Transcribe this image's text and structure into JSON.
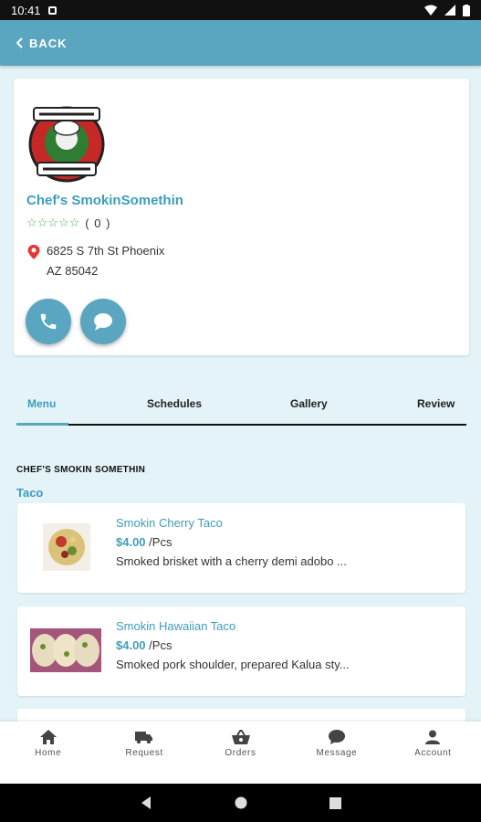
{
  "status_bar": {
    "time": "10:41"
  },
  "app_bar": {
    "back_label": "BACK"
  },
  "profile": {
    "name": "Chef's SmokinSomethin",
    "rating_stars": "☆☆☆☆☆",
    "rating_count": "( 0 )",
    "address_line1": "6825 S 7th St Phoenix",
    "address_line2": "AZ 85042"
  },
  "tabs": [
    "Menu",
    "Schedules",
    "Gallery",
    "Review"
  ],
  "menu": {
    "section_title": "CHEF'S SMOKIN SOMETHIN",
    "category": "Taco",
    "items": [
      {
        "name": "Smokin Cherry Taco",
        "price": "$4.00",
        "unit": "/Pcs",
        "description": "Smoked brisket with a cherry demi adobo ..."
      },
      {
        "name": "Smokin Hawaiian Taco",
        "price": "$4.00",
        "unit": "/Pcs",
        "description": "Smoked pork shoulder, prepared Kalua sty..."
      }
    ]
  },
  "bottom_nav": [
    "Home",
    "Request",
    "Orders",
    "Message",
    "Account"
  ],
  "colors": {
    "primary": "#5aa6c1",
    "accent_text": "#3d9dbb",
    "background": "#e3f3f8",
    "rating": "#4caf50",
    "pin": "#e53935"
  }
}
